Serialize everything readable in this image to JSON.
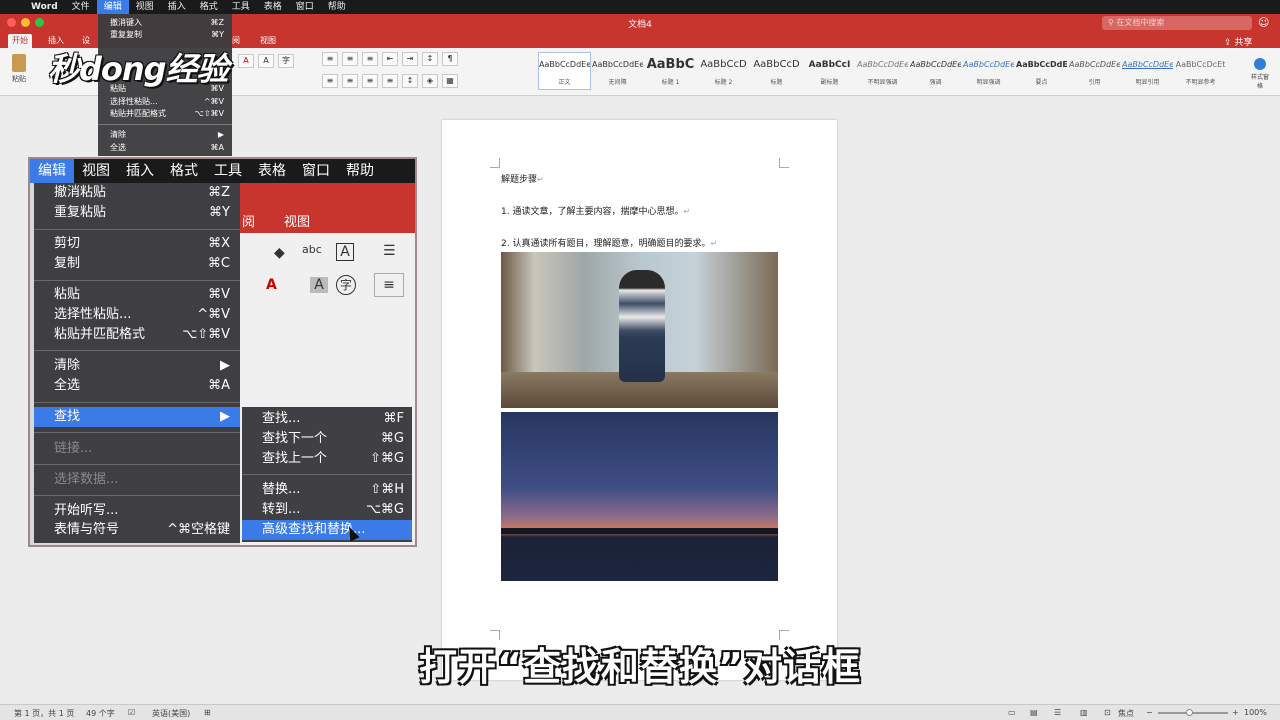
{
  "menubar": {
    "app": "Word",
    "items": [
      "文件",
      "编辑",
      "视图",
      "插入",
      "格式",
      "工具",
      "表格",
      "窗口",
      "帮助"
    ],
    "active": "编辑"
  },
  "window": {
    "title": "文档4",
    "search_placeholder": "在文档中搜索",
    "share_label": "共享"
  },
  "ribbon": {
    "tabs": [
      "开始",
      "插入",
      "设",
      "阅",
      "视图"
    ],
    "paste_label": "粘贴",
    "styles": [
      {
        "sample": "AaBbCcDdEe",
        "name": "正文"
      },
      {
        "sample": "AaBbCcDdEe",
        "name": "无间隔"
      },
      {
        "sample": "AaBbC",
        "name": "标题 1"
      },
      {
        "sample": "AaBbCcD",
        "name": "标题 2"
      },
      {
        "sample": "AaBbCcD",
        "name": "标题"
      },
      {
        "sample": "AaBbCcI",
        "name": "副标题"
      },
      {
        "sample": "AaBbCcDdEe",
        "name": "不明显强调"
      },
      {
        "sample": "AaBbCcDdEe",
        "name": "强调"
      },
      {
        "sample": "AaBbCcDdEe",
        "name": "明显强调"
      },
      {
        "sample": "AaBbCcDdEe",
        "name": "要点"
      },
      {
        "sample": "AaBbCcDdEe",
        "name": "引用"
      },
      {
        "sample": "AaBbCcDdEe",
        "name": "明显引用"
      },
      {
        "sample": "AaBbCcDcEt",
        "name": "不明显参考"
      }
    ],
    "styles_pane_label": "样式窗格"
  },
  "small_menu": {
    "items": [
      {
        "label": "撤消键入",
        "shortcut": "⌘Z"
      },
      {
        "label": "重复复制",
        "shortcut": "⌘Y"
      },
      {
        "label": "粘贴",
        "shortcut": "⌘V"
      },
      {
        "label": "选择性粘贴...",
        "shortcut": "^⌘V"
      },
      {
        "label": "粘贴并匹配格式",
        "shortcut": "⌥⇧⌘V"
      },
      {
        "label": "清除",
        "shortcut": "▶"
      },
      {
        "label": "全选",
        "shortcut": "⌘A"
      }
    ]
  },
  "logo": {
    "text": "秒dong经验"
  },
  "zoom": {
    "menubar": [
      "编辑",
      "视图",
      "插入",
      "格式",
      "工具",
      "表格",
      "窗口",
      "帮助"
    ],
    "bg_tabs": [
      "阅",
      "视图"
    ],
    "edit_menu": [
      {
        "label": "撤消粘贴",
        "shortcut": "⌘Z"
      },
      {
        "label": "重复粘贴",
        "shortcut": "⌘Y"
      },
      {
        "label": "剪切",
        "shortcut": "⌘X"
      },
      {
        "label": "复制",
        "shortcut": "⌘C"
      },
      {
        "label": "粘贴",
        "shortcut": "⌘V"
      },
      {
        "label": "选择性粘贴...",
        "shortcut": "^⌘V"
      },
      {
        "label": "粘贴并匹配格式",
        "shortcut": "⌥⇧⌘V"
      },
      {
        "label": "清除",
        "shortcut": "▶"
      },
      {
        "label": "全选",
        "shortcut": "⌘A"
      },
      {
        "label": "查找",
        "shortcut": "▶"
      },
      {
        "label": "链接...",
        "shortcut": ""
      },
      {
        "label": "选择数据...",
        "shortcut": ""
      },
      {
        "label": "开始听写...",
        "shortcut": ""
      },
      {
        "label": "表情与符号",
        "shortcut": "^⌘空格键"
      }
    ],
    "find_submenu": [
      {
        "label": "查找...",
        "shortcut": "⌘F"
      },
      {
        "label": "查找下一个",
        "shortcut": "⌘G"
      },
      {
        "label": "查找上一个",
        "shortcut": "⇧⌘G"
      },
      {
        "label": "替换...",
        "shortcut": "⇧⌘H"
      },
      {
        "label": "转到...",
        "shortcut": "⌥⌘G"
      },
      {
        "label": "高级查找和替换...",
        "shortcut": ""
      }
    ]
  },
  "document": {
    "heading": "解题步骤",
    "step1": "1.  通读文章，了解主要内容，揣摩中心思想。",
    "step2": "2.  认真通读所有题目，理解题意，明确题目的要求。"
  },
  "caption": "打开“查找和替换”对话框",
  "statusbar": {
    "page": "第 1 页，共 1 页",
    "words": "49 个字",
    "language": "英语(美国)",
    "focus": "焦点",
    "zoom": "100%"
  },
  "colors": {
    "accent": "#c8352e",
    "highlight": "#3b7be8"
  }
}
